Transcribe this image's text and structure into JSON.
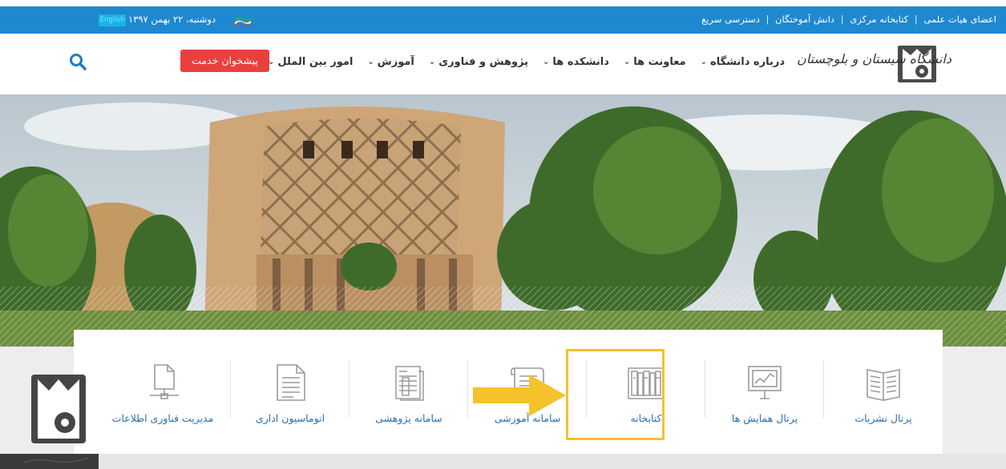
{
  "topbar": {
    "links": [
      "اعضای هیات علمی",
      "کتابخانه مرکزی",
      "دانش آموختگان",
      "دسترسی سریع"
    ],
    "date": "دوشنبه، ۲۲ بهمن ۱۳۹۷",
    "english_label": "English"
  },
  "header": {
    "logo_text": "دانشگاه سیستان و بلوچستان",
    "nav": [
      {
        "label": "درباره دانشگاه",
        "icon": "chevron-down-icon"
      },
      {
        "label": "معاونت ها",
        "icon": "chevron-down-icon"
      },
      {
        "label": "دانشکده ها",
        "icon": "chevron-down-icon"
      },
      {
        "label": "پژوهش و فناوری",
        "icon": "chevron-down-icon"
      },
      {
        "label": "آموزش",
        "icon": "chevron-down-icon"
      },
      {
        "label": "امور بین الملل",
        "icon": "chevron-down-icon"
      }
    ],
    "service_button": "پیشخوان خدمت",
    "search_icon": "search-icon"
  },
  "cards": [
    {
      "label": "پرتال نشریات",
      "icon": "open-book-icon"
    },
    {
      "label": "پرتال همایش ها",
      "icon": "presentation-board-icon"
    },
    {
      "label": "کتابخانه",
      "icon": "bookshelf-icon",
      "highlighted": true
    },
    {
      "label": "سامانه آموزشی",
      "icon": "scroll-document-icon"
    },
    {
      "label": "سامانه پژوهشی",
      "icon": "documents-icon"
    },
    {
      "label": "اتوماسیون اداری",
      "icon": "text-document-icon"
    },
    {
      "label": "مدیریت فناوری اطلاعات",
      "icon": "network-file-icon"
    }
  ],
  "footer_logo_caption": "مدیریت فناوری اطلاعات",
  "colors": {
    "topbar": "#1e88d0",
    "service_button": "#e9403d",
    "card_label": "#2b6fb3",
    "highlight": "#f5c22b",
    "search_icon": "#1e7fc4"
  }
}
